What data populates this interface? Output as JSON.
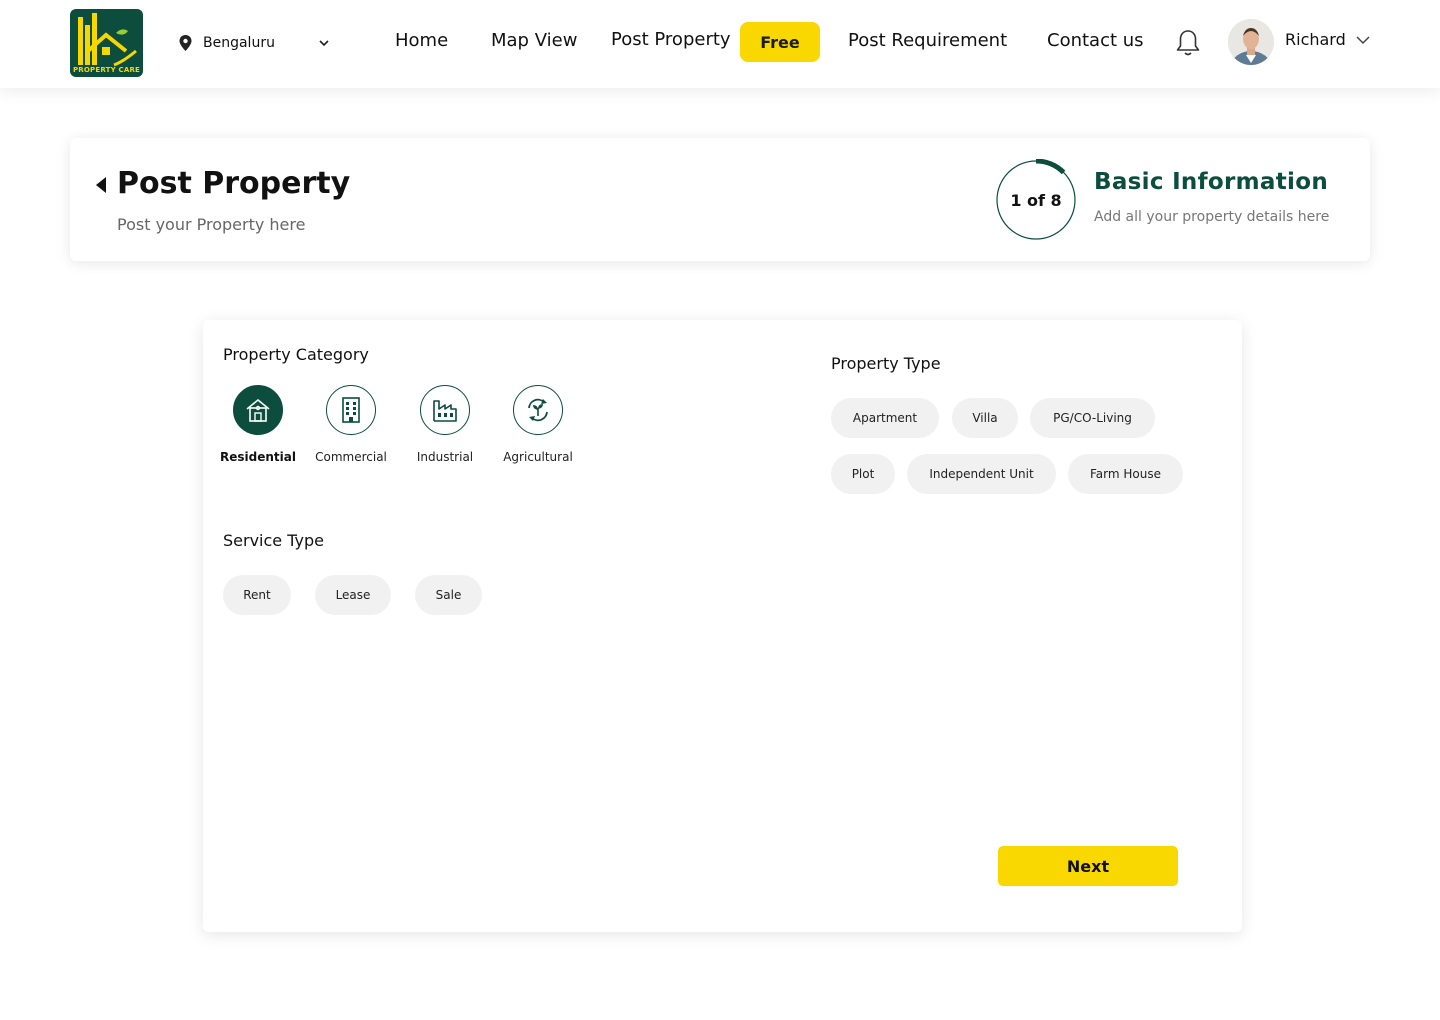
{
  "header": {
    "logo_text": "PROPERTY CARE",
    "location": "Bengaluru",
    "nav": {
      "home": "Home",
      "map_view": "Map View",
      "post_property": "Post Property",
      "free_badge": "Free",
      "post_requirement": "Post Requirement",
      "contact_us": "Contact us"
    },
    "user_name": "Richard"
  },
  "title_card": {
    "title": "Post Property",
    "subtitle": "Post your Property here",
    "step_label": "1 of 8",
    "step_current": 1,
    "step_total": 8,
    "step_title": "Basic Information",
    "step_subtitle": "Add all your property details here"
  },
  "form": {
    "property_category": {
      "label": "Property Category",
      "options": [
        {
          "label": "Residential",
          "icon": "house-icon",
          "selected": true
        },
        {
          "label": "Commercial",
          "icon": "office-building-icon",
          "selected": false
        },
        {
          "label": "Industrial",
          "icon": "factory-icon",
          "selected": false
        },
        {
          "label": "Agricultural",
          "icon": "plant-icon",
          "selected": false
        }
      ]
    },
    "property_type": {
      "label": "Property Type",
      "options": [
        "Apartment",
        "Villa",
        "PG/CO-Living",
        "Plot",
        "Independent Unit",
        "Farm House"
      ]
    },
    "service_type": {
      "label": "Service Type",
      "options": [
        "Rent",
        "Lease",
        "Sale"
      ]
    },
    "next_label": "Next"
  },
  "colors": {
    "brand_green": "#0c4d3e",
    "accent_yellow": "#f8d800",
    "pill_bg": "#f1f1f1"
  }
}
